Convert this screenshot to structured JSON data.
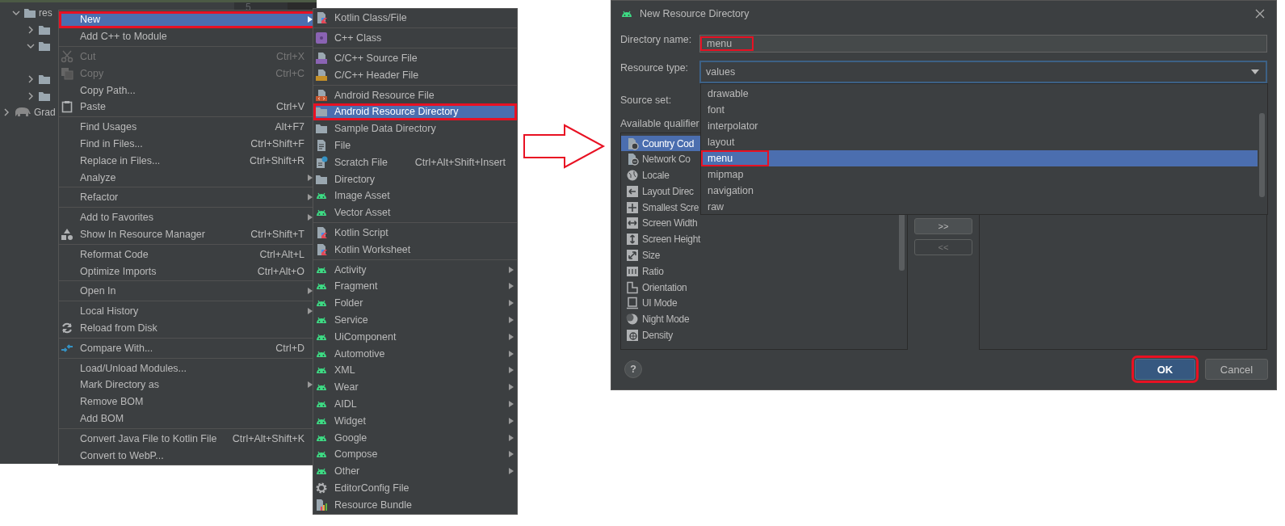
{
  "ide": {
    "gutter_line": "5",
    "tree": [
      {
        "label": "res",
        "expanded": true,
        "children": [
          {
            "expanded": false
          },
          {
            "expanded": true
          },
          {
            "expanded": false
          },
          {
            "expanded": false
          }
        ]
      },
      {
        "label": "Grad",
        "expanded": false
      }
    ]
  },
  "context_menu": [
    [
      {
        "label": "New",
        "kind": "plain",
        "selected": true,
        "disabled": false,
        "has_submenu": true,
        "annotated": true
      },
      {
        "label": "Add C++ to Module",
        "kind": "plain",
        "selected": false,
        "disabled": false,
        "has_submenu": false,
        "annotated": false
      }
    ],
    [
      {
        "label": "Cut",
        "shortcut": "Ctrl+X",
        "kind": "scissors",
        "selected": false,
        "disabled": true,
        "has_submenu": false,
        "annotated": false
      },
      {
        "label": "Copy",
        "shortcut": "Ctrl+C",
        "kind": "copy",
        "selected": false,
        "disabled": true,
        "has_submenu": false,
        "annotated": false
      },
      {
        "label": "Copy Path...",
        "kind": "plain",
        "selected": false,
        "disabled": false,
        "has_submenu": false,
        "annotated": false
      },
      {
        "label": "Paste",
        "shortcut": "Ctrl+V",
        "kind": "clipboard",
        "selected": false,
        "disabled": false,
        "has_submenu": false,
        "annotated": false
      }
    ],
    [
      {
        "label": "Find Usages",
        "shortcut": "Alt+F7",
        "kind": "plain",
        "selected": false,
        "disabled": false,
        "has_submenu": false,
        "annotated": false
      },
      {
        "label": "Find in Files...",
        "shortcut": "Ctrl+Shift+F",
        "kind": "plain",
        "selected": false,
        "disabled": false,
        "has_submenu": false,
        "annotated": false
      },
      {
        "label": "Replace in Files...",
        "shortcut": "Ctrl+Shift+R",
        "kind": "plain",
        "selected": false,
        "disabled": false,
        "has_submenu": false,
        "annotated": false
      },
      {
        "label": "Analyze",
        "kind": "plain",
        "selected": false,
        "disabled": false,
        "has_submenu": true,
        "annotated": false
      }
    ],
    [
      {
        "label": "Refactor",
        "kind": "plain",
        "selected": false,
        "disabled": false,
        "has_submenu": true,
        "annotated": false
      }
    ],
    [
      {
        "label": "Add to Favorites",
        "kind": "plain",
        "selected": false,
        "disabled": false,
        "has_submenu": true,
        "annotated": false
      },
      {
        "label": "Show In Resource Manager",
        "shortcut": "Ctrl+Shift+T",
        "kind": "shapes",
        "selected": false,
        "disabled": false,
        "has_submenu": false,
        "annotated": false
      }
    ],
    [
      {
        "label": "Reformat Code",
        "shortcut": "Ctrl+Alt+L",
        "kind": "plain",
        "selected": false,
        "disabled": false,
        "has_submenu": false,
        "annotated": false
      },
      {
        "label": "Optimize Imports",
        "shortcut": "Ctrl+Alt+O",
        "kind": "plain",
        "selected": false,
        "disabled": false,
        "has_submenu": false,
        "annotated": false
      }
    ],
    [
      {
        "label": "Open In",
        "kind": "plain",
        "selected": false,
        "disabled": false,
        "has_submenu": true,
        "annotated": false
      }
    ],
    [
      {
        "label": "Local History",
        "kind": "plain",
        "selected": false,
        "disabled": false,
        "has_submenu": true,
        "annotated": false
      },
      {
        "label": "Reload from Disk",
        "kind": "reload",
        "selected": false,
        "disabled": false,
        "has_submenu": false,
        "annotated": false
      }
    ],
    [
      {
        "label": "Compare With...",
        "shortcut": "Ctrl+D",
        "kind": "compare",
        "selected": false,
        "disabled": false,
        "has_submenu": false,
        "annotated": false
      }
    ],
    [
      {
        "label": "Load/Unload Modules...",
        "kind": "plain",
        "selected": false,
        "disabled": false,
        "has_submenu": false,
        "annotated": false
      },
      {
        "label": "Mark Directory as",
        "kind": "plain",
        "selected": false,
        "disabled": false,
        "has_submenu": true,
        "annotated": false
      },
      {
        "label": "Remove BOM",
        "kind": "plain",
        "selected": false,
        "disabled": false,
        "has_submenu": false,
        "annotated": false
      },
      {
        "label": "Add BOM",
        "kind": "plain",
        "selected": false,
        "disabled": false,
        "has_submenu": false,
        "annotated": false
      }
    ],
    [
      {
        "label": "Convert Java File to Kotlin File",
        "shortcut": "Ctrl+Alt+Shift+K",
        "kind": "plain",
        "selected": false,
        "disabled": false,
        "has_submenu": false,
        "annotated": false
      },
      {
        "label": "Convert to WebP...",
        "kind": "plain",
        "selected": false,
        "disabled": false,
        "has_submenu": false,
        "annotated": false
      }
    ]
  ],
  "new_submenu": [
    [
      {
        "label": "Kotlin Class/File",
        "kind": "kotlin-file",
        "selected": false,
        "has_submenu": false,
        "annotated": false
      }
    ],
    [
      {
        "label": "C++ Class",
        "kind": "class",
        "selected": false,
        "has_submenu": false,
        "annotated": false
      }
    ],
    [
      {
        "label": "C/C++ Source File",
        "kind": "source-file",
        "selected": false,
        "has_submenu": false,
        "annotated": false
      },
      {
        "label": "C/C++ Header File",
        "kind": "header-file",
        "selected": false,
        "has_submenu": false,
        "annotated": false
      }
    ],
    [
      {
        "label": "Android Resource File",
        "kind": "resource-file",
        "selected": false,
        "has_submenu": false,
        "annotated": false
      },
      {
        "label": "Android Resource Directory",
        "kind": "folder",
        "selected": true,
        "has_submenu": false,
        "annotated": true
      },
      {
        "label": "Sample Data Directory",
        "kind": "folder",
        "selected": false,
        "has_submenu": false,
        "annotated": false
      },
      {
        "label": "File",
        "kind": "file",
        "selected": false,
        "has_submenu": false,
        "annotated": false
      },
      {
        "label": "Scratch File",
        "shortcut": "Ctrl+Alt+Shift+Insert",
        "kind": "scratch",
        "selected": false,
        "has_submenu": false,
        "annotated": false
      },
      {
        "label": "Directory",
        "kind": "folder",
        "selected": false,
        "has_submenu": false,
        "annotated": false
      },
      {
        "label": "Image Asset",
        "kind": "robot",
        "selected": false,
        "has_submenu": false,
        "annotated": false
      },
      {
        "label": "Vector Asset",
        "kind": "robot",
        "selected": false,
        "has_submenu": false,
        "annotated": false
      }
    ],
    [
      {
        "label": "Kotlin Script",
        "kind": "kotlin-file",
        "selected": false,
        "has_submenu": false,
        "annotated": false
      },
      {
        "label": "Kotlin Worksheet",
        "kind": "kotlin-file",
        "selected": false,
        "has_submenu": false,
        "annotated": false
      }
    ],
    [
      {
        "label": "Activity",
        "kind": "robot",
        "selected": false,
        "has_submenu": true,
        "annotated": false
      },
      {
        "label": "Fragment",
        "kind": "robot",
        "selected": false,
        "has_submenu": true,
        "annotated": false
      },
      {
        "label": "Folder",
        "kind": "robot",
        "selected": false,
        "has_submenu": true,
        "annotated": false
      },
      {
        "label": "Service",
        "kind": "robot",
        "selected": false,
        "has_submenu": true,
        "annotated": false
      },
      {
        "label": "UiComponent",
        "kind": "robot",
        "selected": false,
        "has_submenu": true,
        "annotated": false
      },
      {
        "label": "Automotive",
        "kind": "robot",
        "selected": false,
        "has_submenu": true,
        "annotated": false
      },
      {
        "label": "XML",
        "kind": "robot",
        "selected": false,
        "has_submenu": true,
        "annotated": false
      },
      {
        "label": "Wear",
        "kind": "robot",
        "selected": false,
        "has_submenu": true,
        "annotated": false
      },
      {
        "label": "AIDL",
        "kind": "robot",
        "selected": false,
        "has_submenu": true,
        "annotated": false
      },
      {
        "label": "Widget",
        "kind": "robot",
        "selected": false,
        "has_submenu": true,
        "annotated": false
      },
      {
        "label": "Google",
        "kind": "robot",
        "selected": false,
        "has_submenu": true,
        "annotated": false
      },
      {
        "label": "Compose",
        "kind": "robot",
        "selected": false,
        "has_submenu": true,
        "annotated": false
      },
      {
        "label": "Other",
        "kind": "robot",
        "selected": false,
        "has_submenu": true,
        "annotated": false
      },
      {
        "label": "EditorConfig File",
        "kind": "gear",
        "selected": false,
        "has_submenu": false,
        "annotated": false
      },
      {
        "label": "Resource Bundle",
        "kind": "bundle",
        "selected": false,
        "has_submenu": false,
        "annotated": false
      }
    ]
  ],
  "dialog": {
    "title": "New Resource Directory",
    "directory_name": {
      "label": "Directory name:",
      "value": "menu",
      "annotated": true
    },
    "resource_type": {
      "label": "Resource type:",
      "value": "values",
      "expanded": true,
      "options": [
        {
          "label": "drawable",
          "selected": false,
          "annotated": false
        },
        {
          "label": "font",
          "selected": false,
          "annotated": false
        },
        {
          "label": "interpolator",
          "selected": false,
          "annotated": false
        },
        {
          "label": "layout",
          "selected": false,
          "annotated": false
        },
        {
          "label": "menu",
          "selected": true,
          "annotated": true
        },
        {
          "label": "mipmap",
          "selected": false,
          "annotated": false
        },
        {
          "label": "navigation",
          "selected": false,
          "annotated": false
        },
        {
          "label": "raw",
          "selected": false,
          "annotated": false
        }
      ]
    },
    "source_set": {
      "label": "Source set:"
    },
    "qualifiers": {
      "label": "Available qualifier",
      "items": [
        {
          "label": "Country Cod",
          "kind": "country",
          "selected": true
        },
        {
          "label": "Network Co",
          "kind": "network",
          "selected": false
        },
        {
          "label": "Locale",
          "kind": "locale",
          "selected": false
        },
        {
          "label": "Layout Direc",
          "kind": "direction",
          "selected": false
        },
        {
          "label": "Smallest Scre",
          "kind": "smallest",
          "selected": false
        },
        {
          "label": "Screen Width",
          "kind": "width",
          "selected": false
        },
        {
          "label": "Screen Height",
          "kind": "height",
          "selected": false
        },
        {
          "label": "Size",
          "kind": "size",
          "selected": false
        },
        {
          "label": "Ratio",
          "kind": "ratio",
          "selected": false
        },
        {
          "label": "Orientation",
          "kind": "orientation",
          "selected": false
        },
        {
          "label": "UI Mode",
          "kind": "uimode",
          "selected": false
        },
        {
          "label": "Night Mode",
          "kind": "night",
          "selected": false
        },
        {
          "label": "Density",
          "kind": "density",
          "selected": false
        }
      ]
    },
    "move_buttons": [
      {
        "label": ">>",
        "disabled": false
      },
      {
        "label": "<<",
        "disabled": true
      }
    ],
    "help": "?",
    "ok": {
      "label": "OK",
      "annotated": true
    },
    "cancel": {
      "label": "Cancel"
    }
  }
}
